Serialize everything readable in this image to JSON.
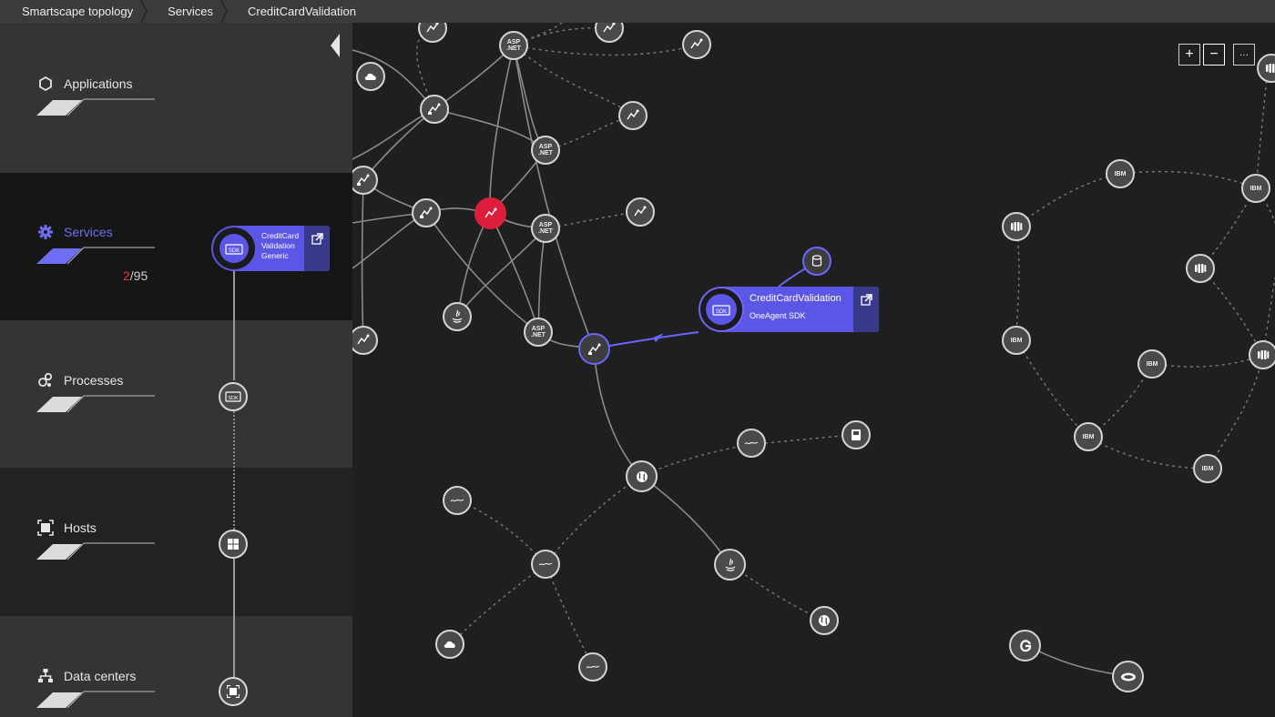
{
  "breadcrumb": {
    "items": [
      "Smartscape topology",
      "Services",
      "CreditCardValidation"
    ]
  },
  "sidebar": {
    "layers": [
      {
        "label": "Applications",
        "icon": "hexagon-icon"
      },
      {
        "label": "Services",
        "icon": "gear-icon",
        "active": true,
        "count_current": "2",
        "count_sep_total": "/95"
      },
      {
        "label": "Processes",
        "icon": "process-icon"
      },
      {
        "label": "Hosts",
        "icon": "host-icon"
      },
      {
        "label": "Data centers",
        "icon": "datacenter-icon"
      }
    ],
    "service_card": {
      "line1": "CreditCard",
      "line2": "Validation",
      "line3": "Generic",
      "icon_text": "SDK"
    }
  },
  "map": {
    "selected_service": {
      "name": "CreditCardValidation",
      "subtitle": "OneAgent SDK",
      "icon_text": "SDK"
    },
    "node_labels": {
      "aspnet": "ASP .NET",
      "ibm": "IBM",
      "sdk": "SDK"
    },
    "zoom": {
      "plus": "+",
      "minus": "−",
      "more": "···"
    }
  },
  "colors": {
    "accent": "#5c56e6",
    "alert": "#dc1e3c",
    "background": "#1f1f20"
  }
}
